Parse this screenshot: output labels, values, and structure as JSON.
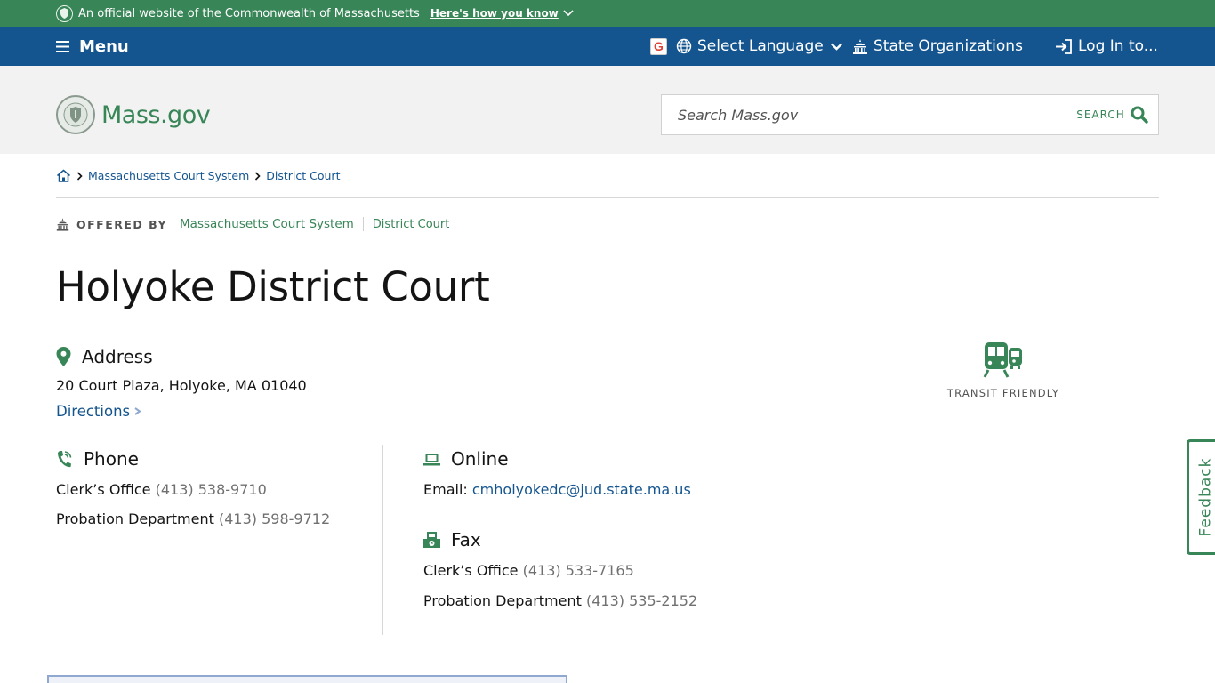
{
  "official_banner": {
    "text": "An official website of the Commonwealth of Massachusetts",
    "toggle_label": "Here's how you know"
  },
  "nav": {
    "menu_label": "Menu",
    "language_label": "Select Language",
    "orgs_label": "State Organizations",
    "login_label": "Log In to..."
  },
  "header": {
    "logo_text": "Mass.gov",
    "search_placeholder": "Search Mass.gov",
    "search_button_label": "SEARCH"
  },
  "breadcrumb": {
    "items": [
      "Massachusetts Court System",
      "District Court"
    ]
  },
  "offered_by": {
    "label": "OFFERED BY",
    "orgs": [
      "Massachusetts Court System",
      "District Court"
    ]
  },
  "page": {
    "title": "Holyoke District Court"
  },
  "address": {
    "heading": "Address",
    "value": "20 Court Plaza, Holyoke, MA 01040",
    "directions_label": "Directions"
  },
  "transit": {
    "label": "TRANSIT FRIENDLY"
  },
  "phone": {
    "heading": "Phone",
    "entries": [
      {
        "label": "Clerk’s Office",
        "number": "(413) 538-9710"
      },
      {
        "label": "Probation Department",
        "number": "(413) 598-9712"
      }
    ]
  },
  "online": {
    "heading": "Online",
    "email_label": "Email:",
    "email": "cmholyokedc@jud.state.ma.us"
  },
  "fax": {
    "heading": "Fax",
    "entries": [
      {
        "label": "Clerk’s Office",
        "number": "(413) 533-7165"
      },
      {
        "label": "Probation Department",
        "number": "(413) 535-2152"
      }
    ]
  },
  "feedback": {
    "label": "Feedback"
  },
  "colors": {
    "green": "#388557",
    "blue": "#14558f",
    "header_bg": "#f2f2f2"
  },
  "icons": [
    "seal-icon",
    "chevron-down-icon",
    "hamburger-icon",
    "google-icon",
    "globe-icon",
    "capitol-icon",
    "login-icon",
    "search-icon",
    "home-icon",
    "map-pin-icon",
    "phone-icon",
    "laptop-icon",
    "fax-icon",
    "transit-icon",
    "arrow-right-icon"
  ]
}
